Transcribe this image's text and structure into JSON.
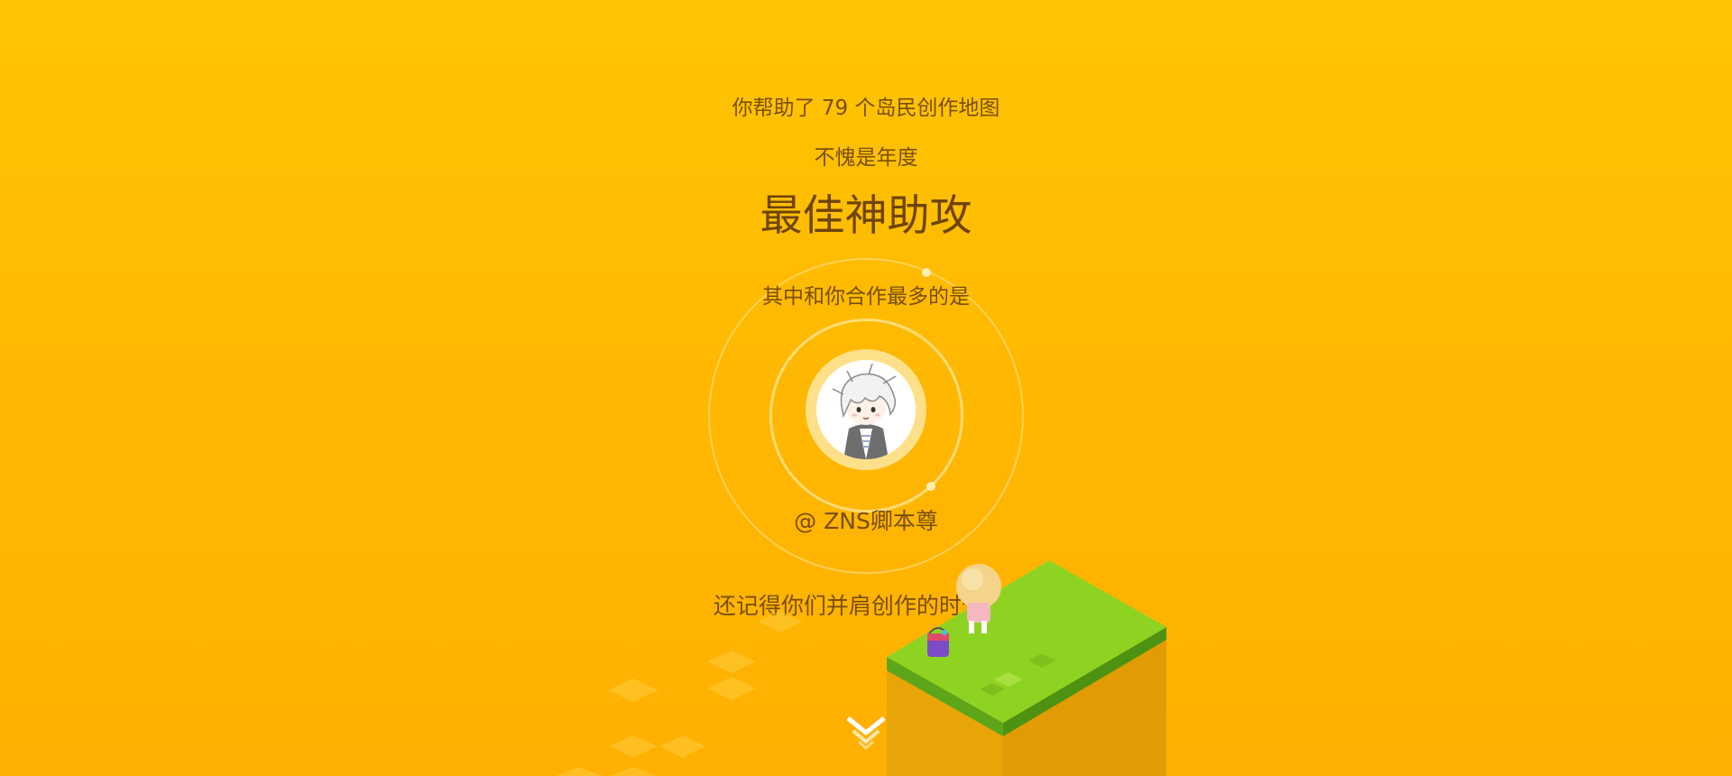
{
  "report": {
    "line1": "你帮助了 79 个岛民创作地图",
    "line2": "不愧是年度",
    "title": "最佳神助攻",
    "partner_intro": "其中和你合作最多的是",
    "partner_handle": "@ ZNS卿本尊",
    "question": "还记得你们并肩创作的时光吗?"
  },
  "colors": {
    "background_top": "#FFC502",
    "background_bottom": "#FFB002",
    "text": "#7A4E08",
    "grass": "#8FD322",
    "cliff": "#E3A106"
  },
  "icons": {
    "partner_avatar": "chibi-white-hair-avatar",
    "scroll_hint": "double-chevron-down-icon",
    "scene": "isometric-grass-island"
  }
}
